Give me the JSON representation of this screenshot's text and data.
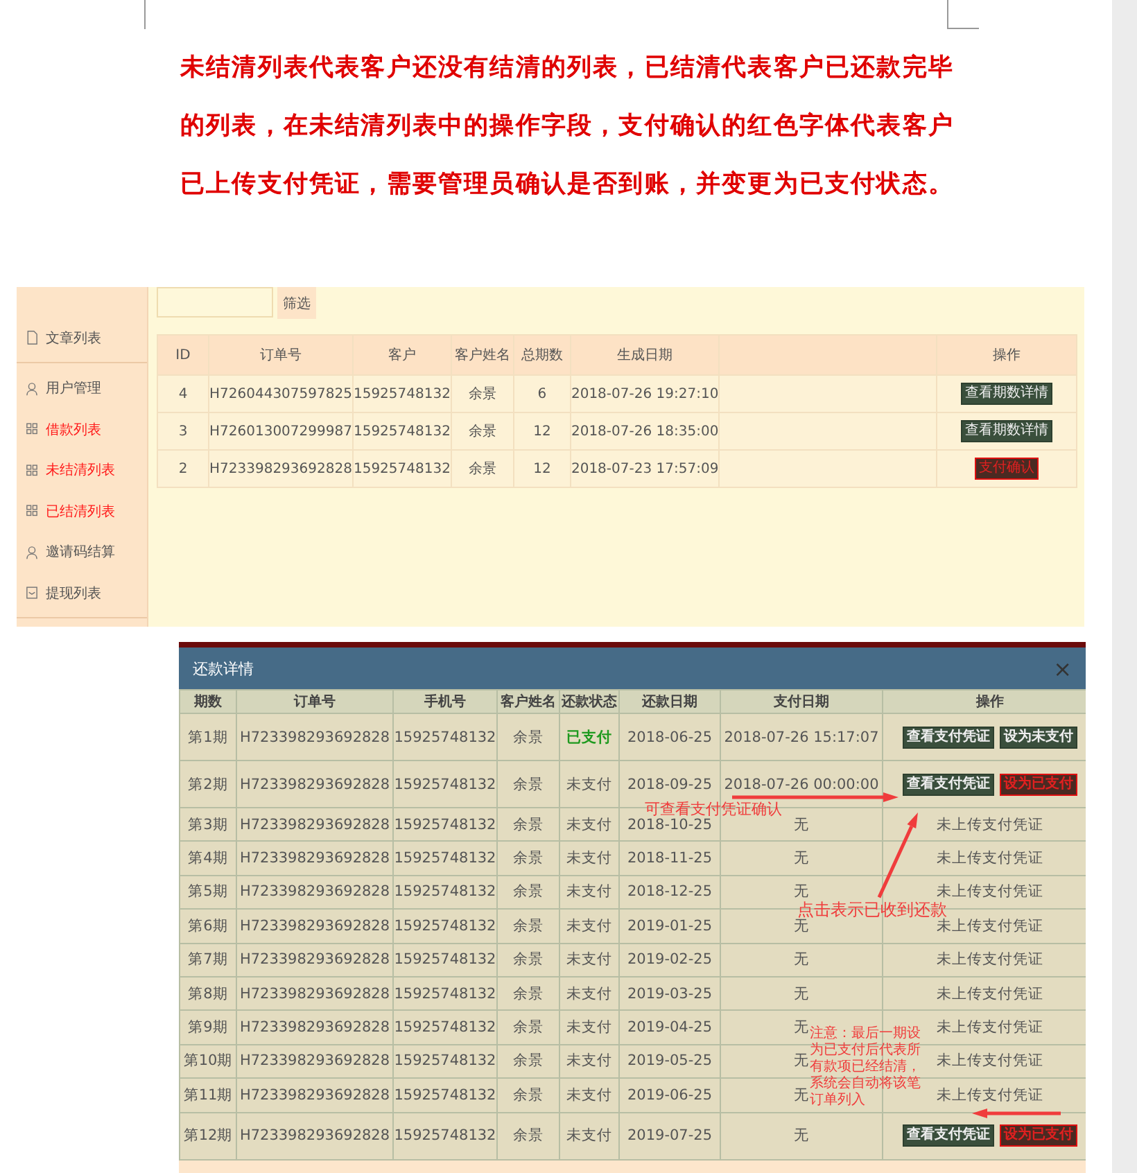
{
  "heading": {
    "lines": [
      "未结清列表代表客户还没有结清的列表，已结清代表客户已还款完毕",
      "的列表，在未结清列表中的操作字段，支付确认的红色字体代表客户",
      "已上传支付凭证，需要管理员确认是否到账，并变更为已支付状态。"
    ]
  },
  "admin": {
    "sidebar": [
      {
        "label": "文章列表",
        "kind": "document",
        "marked": false
      },
      {
        "label": "用户管理",
        "kind": "user",
        "marked": false,
        "divider": true
      },
      {
        "label": "借款列表",
        "kind": "grid",
        "marked": true
      },
      {
        "label": "未结清列表",
        "kind": "grid",
        "marked": true
      },
      {
        "label": "已结清列表",
        "kind": "grid",
        "marked": true
      },
      {
        "label": "邀请码结算",
        "kind": "user",
        "marked": false
      },
      {
        "label": "提现列表",
        "kind": "form",
        "marked": false
      }
    ],
    "filter_button": "筛选",
    "columns": [
      "ID",
      "订单号",
      "客户",
      "客户姓名",
      "总期数",
      "生成日期",
      "",
      "操作"
    ],
    "rows": [
      {
        "cells": [
          "4",
          "H726044307597825",
          "15925748132",
          "余景",
          "6",
          "2018-07-26 19:27:10"
        ],
        "action": {
          "label": "查看期数详情",
          "kind": "view"
        }
      },
      {
        "cells": [
          "3",
          "H726013007299987",
          "15925748132",
          "余景",
          "12",
          "2018-07-26 18:35:00"
        ],
        "action": {
          "label": "查看期数详情",
          "kind": "view"
        }
      },
      {
        "cells": [
          "2",
          "H723398293692828",
          "15925748132",
          "余景",
          "12",
          "2018-07-23 17:57:09"
        ],
        "action": {
          "label": "支付确认",
          "kind": "confirm"
        }
      }
    ]
  },
  "modal": {
    "title": "还款详情",
    "close": "×",
    "columns": [
      "期数",
      "订单号",
      "手机号",
      "客户姓名",
      "还款状态",
      "还款日期",
      "支付日期",
      "操作"
    ],
    "rows": [
      {
        "cells": [
          "第1期",
          "H723398293692828",
          "15925748132",
          "余景"
        ],
        "status": "已支付",
        "paid": true,
        "due": "2018-06-25",
        "paid_date": "2018-07-26 15:17:07",
        "actions": [
          {
            "label": "查看支付凭证",
            "kind": "view"
          },
          {
            "label": "设为未支付",
            "kind": "view"
          }
        ]
      },
      {
        "cells": [
          "第2期",
          "H723398293692828",
          "15925748132",
          "余景"
        ],
        "status": "未支付",
        "paid": false,
        "due": "2018-09-25",
        "paid_date": "2018-07-26 00:00:00",
        "actions": [
          {
            "label": "查看支付凭证",
            "kind": "view"
          },
          {
            "label": "设为已支付",
            "kind": "confirm"
          }
        ]
      },
      {
        "cells": [
          "第3期",
          "H723398293692828",
          "15925748132",
          "余景"
        ],
        "status": "未支付",
        "paid": false,
        "due": "2018-10-25",
        "paid_date": "无",
        "note": "未上传支付凭证"
      },
      {
        "cells": [
          "第4期",
          "H723398293692828",
          "15925748132",
          "余景"
        ],
        "status": "未支付",
        "paid": false,
        "due": "2018-11-25",
        "paid_date": "无",
        "note": "未上传支付凭证"
      },
      {
        "cells": [
          "第5期",
          "H723398293692828",
          "15925748132",
          "余景"
        ],
        "status": "未支付",
        "paid": false,
        "due": "2018-12-25",
        "paid_date": "无",
        "note": "未上传支付凭证"
      },
      {
        "cells": [
          "第6期",
          "H723398293692828",
          "15925748132",
          "余景"
        ],
        "status": "未支付",
        "paid": false,
        "due": "2019-01-25",
        "paid_date": "无",
        "note": "未上传支付凭证"
      },
      {
        "cells": [
          "第7期",
          "H723398293692828",
          "15925748132",
          "余景"
        ],
        "status": "未支付",
        "paid": false,
        "due": "2019-02-25",
        "paid_date": "无",
        "note": "未上传支付凭证"
      },
      {
        "cells": [
          "第8期",
          "H723398293692828",
          "15925748132",
          "余景"
        ],
        "status": "未支付",
        "paid": false,
        "due": "2019-03-25",
        "paid_date": "无",
        "note": "未上传支付凭证"
      },
      {
        "cells": [
          "第9期",
          "H723398293692828",
          "15925748132",
          "余景"
        ],
        "status": "未支付",
        "paid": false,
        "due": "2019-04-25",
        "paid_date": "无",
        "note": "未上传支付凭证"
      },
      {
        "cells": [
          "第10期",
          "H723398293692828",
          "15925748132",
          "余景"
        ],
        "status": "未支付",
        "paid": false,
        "due": "2019-05-25",
        "paid_date": "无",
        "note": "未上传支付凭证"
      },
      {
        "cells": [
          "第11期",
          "H723398293692828",
          "15925748132",
          "余景"
        ],
        "status": "未支付",
        "paid": false,
        "due": "2019-06-25",
        "paid_date": "无",
        "note": "未上传支付凭证"
      },
      {
        "cells": [
          "第12期",
          "H723398293692828",
          "15925748132",
          "余景"
        ],
        "status": "未支付",
        "paid": false,
        "due": "2019-07-25",
        "paid_date": "无",
        "actions": [
          {
            "label": "查看支付凭证",
            "kind": "view"
          },
          {
            "label": "设为已支付",
            "kind": "confirm"
          }
        ]
      }
    ],
    "annotations": [
      "可查看支付凭证确认",
      "点击表示已收到还款",
      "注意：最后一期设为已支付后代表所有款项已经结清，系统会自动将该笔订单列入"
    ]
  }
}
